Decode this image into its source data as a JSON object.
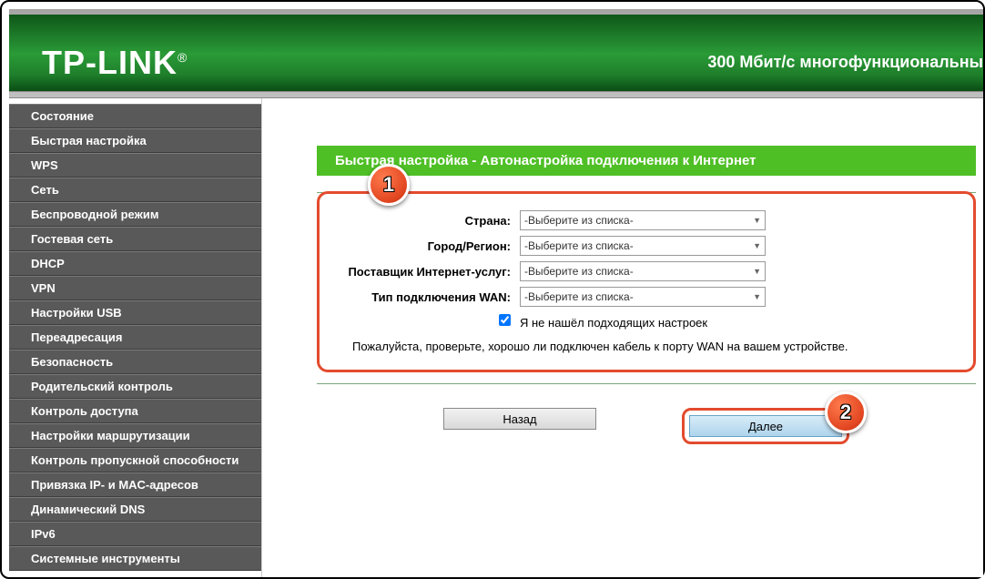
{
  "header": {
    "logo_text": "TP-LINK",
    "logo_reg": "®",
    "subtitle": "300 Мбит/с многофункциональны"
  },
  "sidebar": {
    "items": [
      "Состояние",
      "Быстрая настройка",
      "WPS",
      "Сеть",
      "Беспроводной режим",
      "Гостевая сеть",
      "DHCP",
      "VPN",
      "Настройки USB",
      "Переадресация",
      "Безопасность",
      "Родительский контроль",
      "Контроль доступа",
      "Настройки маршрутизации",
      "Контроль пропускной способности",
      "Привязка IP- и MAC-адресов",
      "Динамический DNS",
      "IPv6",
      "Системные инструменты"
    ]
  },
  "panel": {
    "title": "Быстрая настройка - Автонастройка подключения к Интернет"
  },
  "form": {
    "country_label": "Страна:",
    "city_label": "Город/Регион:",
    "isp_label": "Поставщик Интернет-услуг:",
    "wan_label": "Тип подключения WAN:",
    "select_placeholder": "-Выберите из списка-",
    "checkbox_label": "Я не нашёл подходящих настроек",
    "note": "Пожалуйста, проверьте, хорошо ли подключен кабель к порту WAN на вашем устройстве."
  },
  "buttons": {
    "back": "Назад",
    "next": "Далее"
  },
  "callouts": {
    "one": "1",
    "two": "2"
  }
}
